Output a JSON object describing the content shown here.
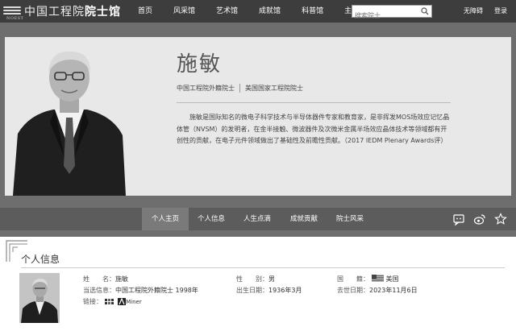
{
  "header": {
    "logo_abbr": "NOEST",
    "logo_title_main": "中国工程院",
    "logo_title_sub": "院士馆",
    "nav": [
      "首页",
      "风采馆",
      "艺术馆",
      "成就馆",
      "科普馆",
      "主题展"
    ],
    "search_placeholder": "搜索院士",
    "accessibility": "无障碍",
    "login": "登录"
  },
  "profile": {
    "name": "施敏",
    "tags": [
      "中国工程院外籍院士",
      "美国国家工程院院士"
    ],
    "bio": "施敏是国际知名的微电子科学技术与半导体器件专家和教育家，是非挥发MOS场效应记忆晶体管（NVSM）的发明者，在金半接触、微波器件及次微米金属半场效应晶体技术等领域都有开创性的贡献，在电子元件领域做出了基础性及前瞻性贡献。（2017 IEDM Plenary Awards评）"
  },
  "tabs": [
    "个人主页",
    "个人信息",
    "人生点滴",
    "成就贡献",
    "院士风采"
  ],
  "active_tab": 0,
  "section": {
    "title": "个人信息",
    "name_label": "姓　　名：",
    "name_value": "施敏",
    "gender_label": "性　　别：",
    "gender_value": "男",
    "country_label": "国　　籍：",
    "country_value": "美国",
    "elected_label": "当选信息：",
    "elected_value": "中国工程院外籍院士 1998年",
    "birth_label": "出生日期：",
    "birth_value": "1936年3月",
    "death_label": "去世日期：",
    "death_value": "2023年11月6日",
    "links_label": "链接：",
    "link2_text": "Miner"
  },
  "icons": {
    "search": "search-icon",
    "wechat": "wechat-icon",
    "weibo": "weibo-icon",
    "star": "star-icon"
  }
}
